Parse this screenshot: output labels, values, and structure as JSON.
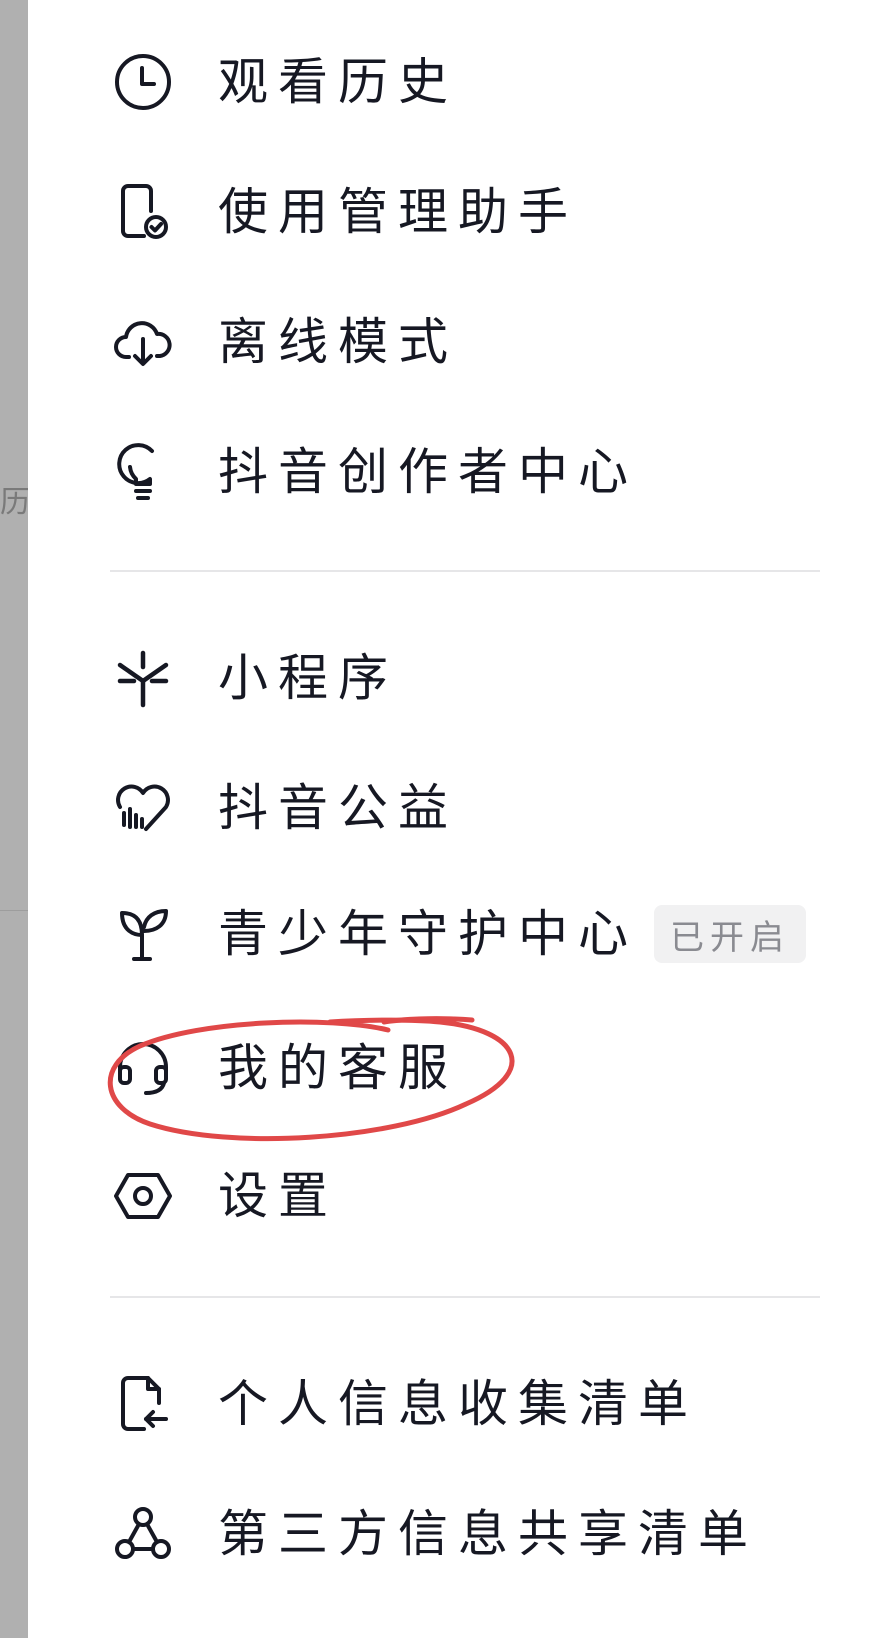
{
  "background_fragment": {
    "text": "历"
  },
  "menu": {
    "group1": [
      {
        "id": "watch-history",
        "icon": "clock-icon",
        "label": "观看历史"
      },
      {
        "id": "usage-manager",
        "icon": "phone-check-icon",
        "label": "使用管理助手"
      },
      {
        "id": "offline-mode",
        "icon": "cloud-download-icon",
        "label": "离线模式"
      },
      {
        "id": "creator-center",
        "icon": "lightbulb-icon",
        "label": "抖音创作者中心"
      }
    ],
    "group2": [
      {
        "id": "mini-programs",
        "icon": "asterisk-icon",
        "label": "小程序"
      },
      {
        "id": "charity",
        "icon": "heart-chart-icon",
        "label": "抖音公益"
      },
      {
        "id": "youth-protection",
        "icon": "sprout-icon",
        "label": "青少年守护中心",
        "badge": "已开启"
      },
      {
        "id": "customer-service",
        "icon": "headset-icon",
        "label": "我的客服"
      },
      {
        "id": "settings",
        "icon": "hexagon-gear-icon",
        "label": "设置"
      }
    ],
    "group3": [
      {
        "id": "personal-info-list",
        "icon": "document-arrow-icon",
        "label": "个人信息收集清单"
      },
      {
        "id": "third-party-list",
        "icon": "share-nodes-icon",
        "label": "第三方信息共享清单"
      }
    ]
  },
  "colors": {
    "text": "#161823",
    "icon": "#161823",
    "badge_bg": "#f1f1f2",
    "badge_text": "#8a8b91",
    "annotation": "#e04848",
    "side_strip": "#b0b0b0"
  }
}
